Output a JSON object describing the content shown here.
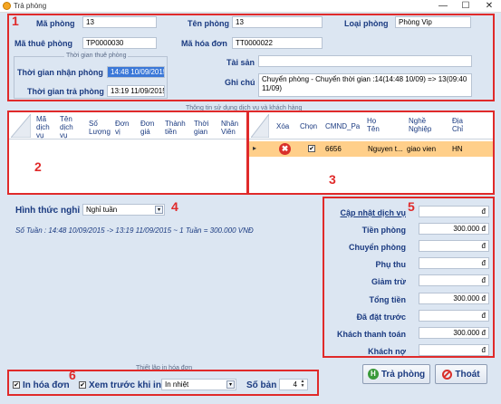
{
  "window": {
    "title": "Trả phòng",
    "minimize": "—",
    "maximize": "☐",
    "close": "✕"
  },
  "markers": {
    "m1": "1",
    "m2": "2",
    "m3": "3",
    "m4": "4",
    "m5": "5",
    "m6": "6"
  },
  "room": {
    "ma_phong_label": "Mã phòng",
    "ma_phong": "13",
    "ten_phong_label": "Tên phòng",
    "ten_phong": "13",
    "loai_phong_label": "Loại phòng",
    "loai_phong": "Phòng Vip",
    "ma_thue_label": "Mã thuê phòng",
    "ma_thue": "TP0000030",
    "ma_hoa_don_label": "Mã hóa đơn",
    "ma_hoa_don": "TT0000022",
    "group_title": "Thời gian thuê phòng",
    "nhan_label": "Thời gian nhận phòng",
    "nhan": "14:48 10/09/2015",
    "tra_label": "Thời gian trả phòng",
    "tra": "13:19 11/09/2015",
    "tai_san_label": "Tài sản",
    "tai_san": "",
    "ghi_chu_label": "Ghi chú",
    "ghi_chu": "Chuyển phòng - Chuyển thời gian :14(14:48 10/09) => 13(09:40 11/09)"
  },
  "section_title": "Thông tin sử dụng dịch vụ và khách hàng",
  "services": {
    "columns": [
      "Mã dịch vụ",
      "Tên dịch vụ",
      "Số Lượng",
      "Đơn vị",
      "Đơn giá",
      "Thành tiền",
      "Thời gian",
      "Nhân Viên"
    ]
  },
  "customers": {
    "columns": [
      "Xóa",
      "Chọn",
      "CMND_Pa",
      "Họ Tên",
      "Nghề Nghiệp",
      "Địa Chỉ"
    ],
    "rows": [
      {
        "xoa": "✖",
        "chon": "✔",
        "cmnd": "6656",
        "ho_ten": "Nguyen t...",
        "nghe": "giao vien",
        "dia_chi": "HN"
      }
    ],
    "row_pointer": "▸"
  },
  "payment": {
    "label": "Hình thức nghỉ",
    "value": "Nghỉ tuần",
    "summary": "Số Tuần : 14:48 10/09/2015 -> 13:19 11/09/2015 ~ 1 Tuần = 300.000 VNĐ"
  },
  "totals": {
    "cap_nhat_label": "Cập nhật dịch vụ",
    "cap_nhat": "đ",
    "tien_phong_label": "Tiền phòng",
    "tien_phong": "300.000 đ",
    "chuyen_phong_label": "Chuyển phòng",
    "chuyen_phong": "đ",
    "phu_thu_label": "Phụ thu",
    "phu_thu": "đ",
    "giam_tru_label": "Giảm trừ",
    "giam_tru": "đ",
    "tong_tien_label": "Tổng tiền",
    "tong_tien": "300.000 đ",
    "da_dat_label": "Đã đặt trước",
    "da_dat": "đ",
    "khach_tt_label": "Khách thanh toán",
    "khach_tt": "300.000 đ",
    "khach_no_label": "Khách nợ",
    "khach_no": "đ"
  },
  "print": {
    "group_title": "Thiết lập in hóa đơn",
    "in_hoa_don": "In hóa đơn",
    "xem_truoc": "Xem trước khi in",
    "printer": "In nhiệt",
    "so_ban_label": "Số bản",
    "so_ban": "4"
  },
  "buttons": {
    "tra_phong": "Trả phòng",
    "thoat": "Thoát"
  },
  "colors": {
    "accent_red": "#e02a2a",
    "selected_row": "#ffcf8a",
    "label_blue": "#1a3a80",
    "panel_bg": "#dce6f2"
  }
}
